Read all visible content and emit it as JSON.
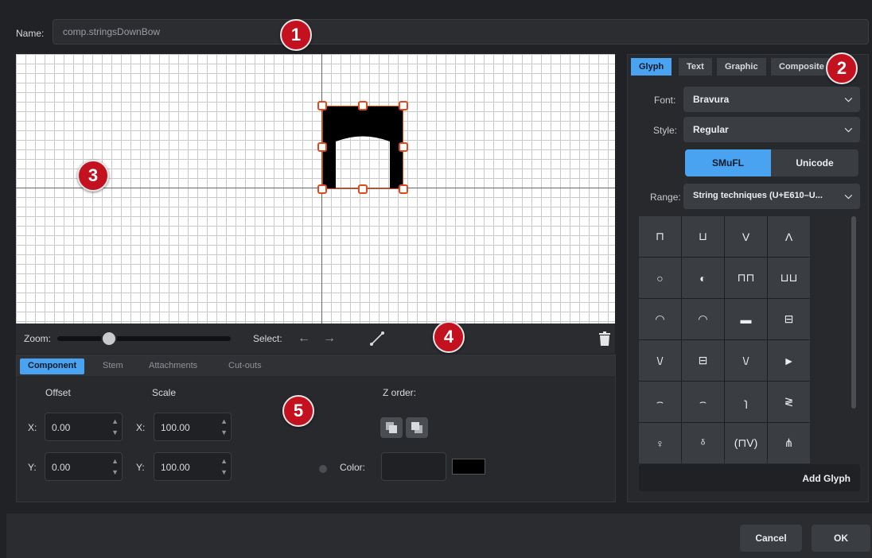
{
  "name": {
    "label": "Name:",
    "value": "comp.stringsDownBow"
  },
  "toolbar": {
    "zoom_label": "Zoom:",
    "zoom_level": 0.3,
    "select_label": "Select:",
    "arrow_left": "←",
    "arrow_right": "→"
  },
  "props": {
    "tabs": [
      "Component",
      "Stem",
      "Attachments",
      "Cut-outs"
    ],
    "offset_label": "Offset",
    "scale_label": "Scale",
    "zorder_label": "Z order:",
    "offset_x": "0.00",
    "offset_y": "0.00",
    "scale_x": "100.00",
    "scale_y": "100.00",
    "x_label": "X:",
    "y_label": "Y:",
    "color_label": "Color:",
    "color_value": "#000000"
  },
  "right": {
    "tabs": [
      "Glyph",
      "Text",
      "Graphic",
      "Composite"
    ],
    "font_label": "Font:",
    "font_value": "Bravura",
    "style_label": "Style:",
    "style_value": "Regular",
    "smufl": "SMuFL",
    "unicode": "Unicode",
    "range_label": "Range:",
    "range_value": "String techniques (U+E610–U...",
    "glyphs": [
      "⊓",
      "⊔",
      "V",
      "Λ",
      "○",
      "◐",
      "⊓⊓",
      "⊔⊔",
      "◠",
      "◠",
      "▬",
      "⊟",
      "\\/",
      "⊟",
      "\\/",
      "►",
      "⌢",
      "⌢",
      "ɿ",
      "≷",
      "♀",
      "ᵟ",
      "(⊓V)",
      "⋔"
    ],
    "add_glyph": "Add Glyph"
  },
  "footer": {
    "cancel": "Cancel",
    "ok": "OK"
  },
  "callouts": [
    "1",
    "2",
    "3",
    "4",
    "5"
  ],
  "colors": {
    "accent": "#4aa3f0",
    "handle": "#e04a1a",
    "callout": "#c3111f"
  }
}
